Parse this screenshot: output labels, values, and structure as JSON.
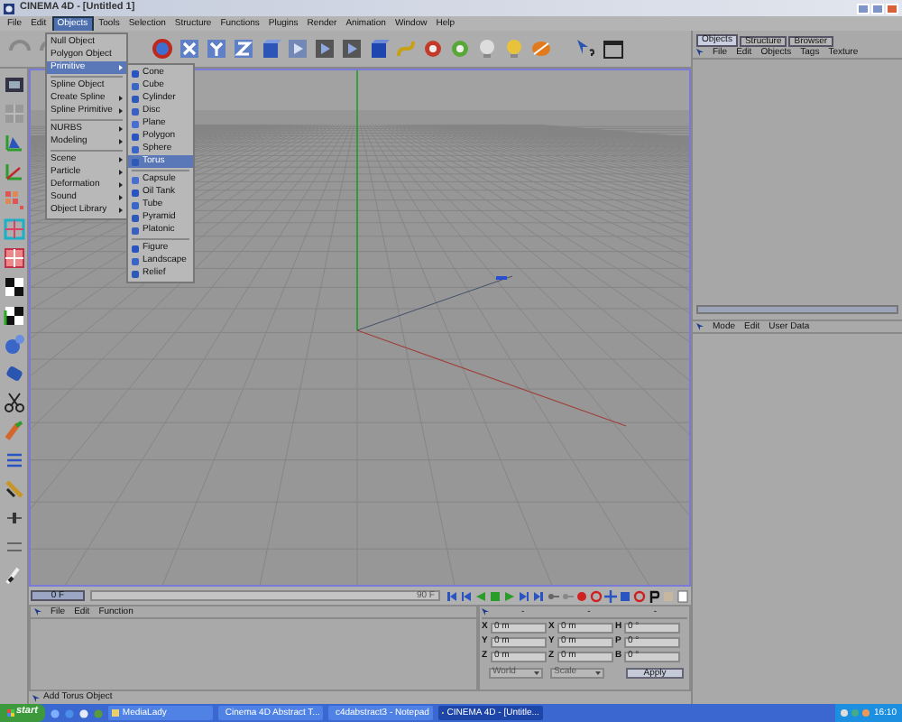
{
  "window": {
    "title": "CINEMA 4D - [Untitled 1]"
  },
  "menu_bar": [
    {
      "label": "File",
      "selected": false
    },
    {
      "label": "Edit",
      "selected": false
    },
    {
      "label": "Objects",
      "selected": true
    },
    {
      "label": "Tools",
      "selected": false
    },
    {
      "label": "Selection",
      "selected": false
    },
    {
      "label": "Structure",
      "selected": false
    },
    {
      "label": "Functions",
      "selected": false
    },
    {
      "label": "Plugins",
      "selected": false
    },
    {
      "label": "Render",
      "selected": false
    },
    {
      "label": "Animation",
      "selected": false
    },
    {
      "label": "Window",
      "selected": false
    },
    {
      "label": "Help",
      "selected": false
    }
  ],
  "objects_menu": [
    {
      "kind": "item",
      "label": "Null Object",
      "selected": false
    },
    {
      "kind": "item",
      "label": "Polygon Object",
      "selected": false
    },
    {
      "kind": "submenu",
      "label": "Primitive",
      "selected": true
    },
    {
      "kind": "separator"
    },
    {
      "kind": "item",
      "label": "Spline Object",
      "selected": false
    },
    {
      "kind": "submenu",
      "label": "Create Spline",
      "selected": false
    },
    {
      "kind": "submenu",
      "label": "Spline Primitive",
      "selected": false
    },
    {
      "kind": "separator"
    },
    {
      "kind": "submenu",
      "label": "NURBS",
      "selected": false
    },
    {
      "kind": "submenu",
      "label": "Modeling",
      "selected": false
    },
    {
      "kind": "separator"
    },
    {
      "kind": "submenu",
      "label": "Scene",
      "selected": false
    },
    {
      "kind": "submenu",
      "label": "Particle",
      "selected": false
    },
    {
      "kind": "submenu",
      "label": "Deformation",
      "selected": false
    },
    {
      "kind": "submenu",
      "label": "Sound",
      "selected": false
    },
    {
      "kind": "submenu",
      "label": "Object Library",
      "selected": false
    }
  ],
  "primitive_menu": [
    {
      "kind": "item",
      "label": "Cone",
      "selected": false
    },
    {
      "kind": "item",
      "label": "Cube",
      "selected": false
    },
    {
      "kind": "item",
      "label": "Cylinder",
      "selected": false
    },
    {
      "kind": "item",
      "label": "Disc",
      "selected": false
    },
    {
      "kind": "item",
      "label": "Plane",
      "selected": false
    },
    {
      "kind": "item",
      "label": "Polygon",
      "selected": false
    },
    {
      "kind": "item",
      "label": "Sphere",
      "selected": false
    },
    {
      "kind": "item",
      "label": "Torus",
      "selected": true
    },
    {
      "kind": "separator"
    },
    {
      "kind": "item",
      "label": "Capsule",
      "selected": false
    },
    {
      "kind": "item",
      "label": "Oil Tank",
      "selected": false
    },
    {
      "kind": "item",
      "label": "Tube",
      "selected": false
    },
    {
      "kind": "item",
      "label": "Pyramid",
      "selected": false
    },
    {
      "kind": "item",
      "label": "Platonic",
      "selected": false
    },
    {
      "kind": "separator"
    },
    {
      "kind": "item",
      "label": "Figure",
      "selected": false
    },
    {
      "kind": "item",
      "label": "Landscape",
      "selected": false
    },
    {
      "kind": "item",
      "label": "Relief",
      "selected": false
    }
  ],
  "object_manager": {
    "tabs": [
      {
        "label": "Objects",
        "selected": true
      },
      {
        "label": "Structure",
        "selected": false
      },
      {
        "label": "Browser",
        "selected": false
      }
    ],
    "menu": [
      "File",
      "Edit",
      "Objects",
      "Tags",
      "Texture"
    ]
  },
  "attribute_manager": {
    "menu": [
      "Mode",
      "Edit",
      "User Data"
    ]
  },
  "timeline": {
    "current_frame": "0 F",
    "end_frame": "90 F"
  },
  "timeline_manager": {
    "menu": [
      "File",
      "Edit",
      "Function"
    ]
  },
  "coordinates": {
    "headers": [
      "-",
      "-",
      "-"
    ],
    "rows": [
      {
        "position_label": "X",
        "position": "0 m",
        "size_label": "X",
        "size": "0 m",
        "rotation_label": "H",
        "rotation": "0 °"
      },
      {
        "position_label": "Y",
        "position": "0 m",
        "size_label": "Y",
        "size": "0 m",
        "rotation_label": "P",
        "rotation": "0 °"
      },
      {
        "position_label": "Z",
        "position": "0 m",
        "size_label": "Z",
        "size": "0 m",
        "rotation_label": "B",
        "rotation": "0 °"
      }
    ],
    "mode": "World",
    "size_mode": "Scale",
    "apply": "Apply"
  },
  "status_bar": "Add Torus Object",
  "taskbar": {
    "start": "start",
    "tasks": [
      {
        "label": "MediaLady",
        "selected": false
      },
      {
        "label": "Cinema 4D Abstract T...",
        "selected": false
      },
      {
        "label": "c4dabstract3 - Notepad",
        "selected": false
      },
      {
        "label": "CINEMA 4D - [Untitle...",
        "selected": true
      }
    ],
    "clock": "16:10"
  }
}
